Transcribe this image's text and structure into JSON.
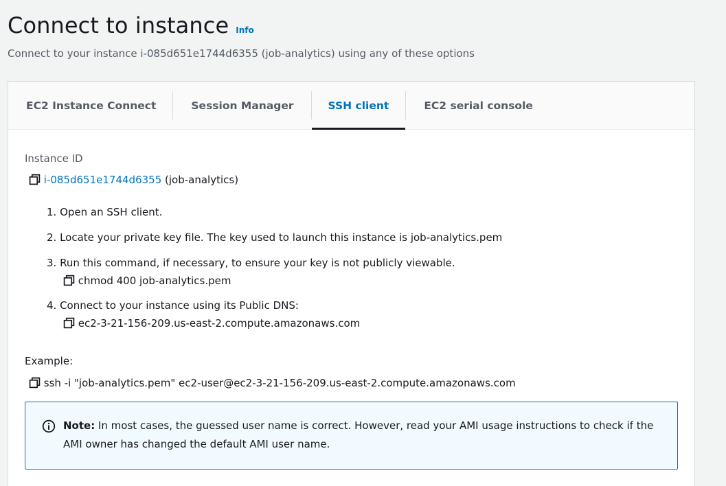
{
  "header": {
    "title": "Connect to instance",
    "info": "Info",
    "subtitle": "Connect to your instance i-085d651e1744d6355 (job-analytics) using any of these options"
  },
  "tabs": [
    {
      "label": "EC2 Instance Connect",
      "active": false
    },
    {
      "label": "Session Manager",
      "active": false
    },
    {
      "label": "SSH client",
      "active": true
    },
    {
      "label": "EC2 serial console",
      "active": false
    }
  ],
  "instance": {
    "label": "Instance ID",
    "id": "i-085d651e1744d6355",
    "name": "(job-analytics)"
  },
  "steps": {
    "s1": "1. Open an SSH client.",
    "s2": "2. Locate your private key file. The key used to launch this instance is job-analytics.pem",
    "s3": "3. Run this command, if necessary, to ensure your key is not publicly viewable.",
    "s3_cmd": "chmod 400 job-analytics.pem",
    "s4": "4. Connect to your instance using its Public DNS:",
    "s4_dns": "ec2-3-21-156-209.us-east-2.compute.amazonaws.com"
  },
  "example": {
    "label": "Example:",
    "command": "ssh -i \"job-analytics.pem\" ec2-user@ec2-3-21-156-209.us-east-2.compute.amazonaws.com"
  },
  "note": {
    "prefix": "Note:",
    "text": " In most cases, the guessed user name is correct. However, read your AMI usage instructions to check if the AMI owner has changed the default AMI user name."
  },
  "colors": {
    "link": "#0073bb",
    "note_bg": "#f1faff",
    "active_tab_underline": "#16191f"
  }
}
